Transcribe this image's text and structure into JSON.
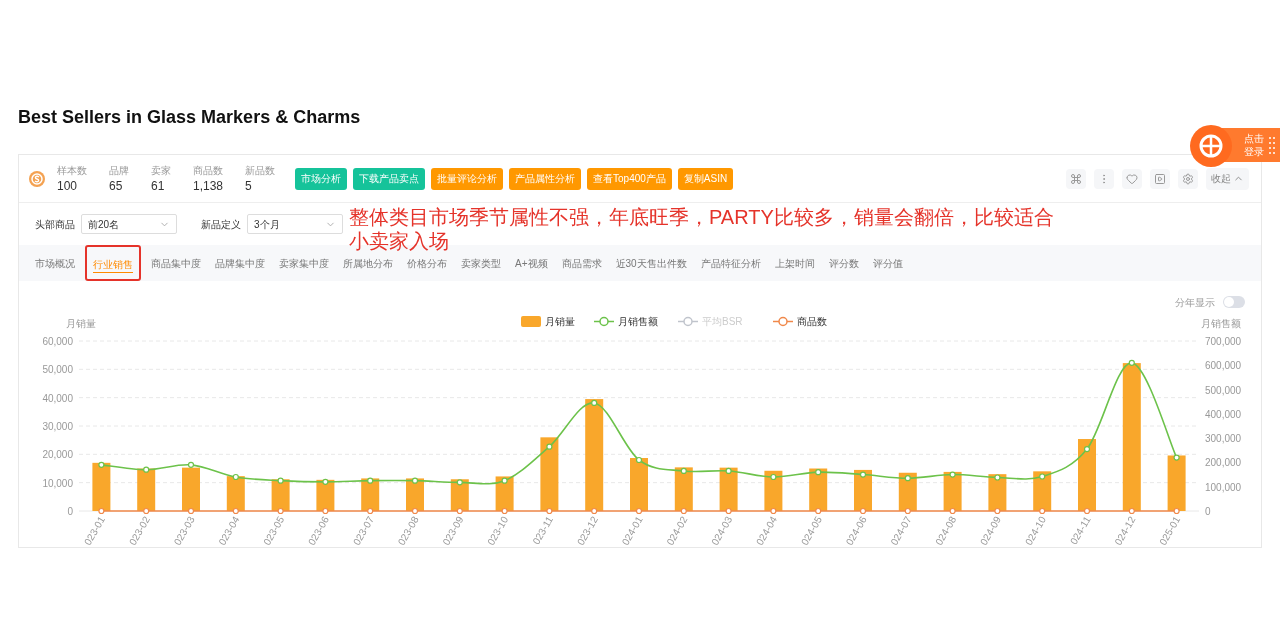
{
  "page_title": "Best Sellers in Glass Markers & Charms",
  "float_login": {
    "line1": "点击",
    "line2": "登录"
  },
  "stats": [
    {
      "label": "样本数",
      "value": "100"
    },
    {
      "label": "品牌",
      "value": "65"
    },
    {
      "label": "卖家",
      "value": "61"
    },
    {
      "label": "商品数",
      "value": "1,138"
    },
    {
      "label": "新品数",
      "value": "5"
    }
  ],
  "actions": [
    {
      "label": "市场分析",
      "kind": "teal"
    },
    {
      "label": "下载产品卖点",
      "kind": "teal"
    },
    {
      "label": "批量评论分析",
      "kind": "orange"
    },
    {
      "label": "产品属性分析",
      "kind": "orange"
    },
    {
      "label": "查看Top400产品",
      "kind": "orange"
    },
    {
      "label": "复制ASIN",
      "kind": "orange"
    }
  ],
  "collapse_button": "收起",
  "filters": [
    {
      "label": "头部商品",
      "value": "前20名"
    },
    {
      "label": "新品定义",
      "value": "3个月"
    }
  ],
  "annotation": "整体类目市场季节属性不强，年底旺季，PARTY比较多，销量会翻倍，比较适合小卖家入场",
  "tabs": [
    {
      "label": "市场概况",
      "selected": false
    },
    {
      "label": "行业销售",
      "selected": true
    },
    {
      "label": "商品集中度",
      "selected": false
    },
    {
      "label": "品牌集中度",
      "selected": false
    },
    {
      "label": "卖家集中度",
      "selected": false
    },
    {
      "label": "所属地分布",
      "selected": false
    },
    {
      "label": "价格分布",
      "selected": false
    },
    {
      "label": "卖家类型",
      "selected": false
    },
    {
      "label": "A+视频",
      "selected": false
    },
    {
      "label": "商品需求",
      "selected": false
    },
    {
      "label": "近30天售出件数",
      "selected": false
    },
    {
      "label": "产品特征分析",
      "selected": false
    },
    {
      "label": "上架时间",
      "selected": false
    },
    {
      "label": "评分数",
      "selected": false
    },
    {
      "label": "评分值",
      "selected": false
    }
  ],
  "chart": {
    "toggle": {
      "label": "分年显示",
      "on": false
    },
    "hidden_legend_item": {
      "label": "平均BSR",
      "color": "#c0c4cc",
      "disabled": true
    },
    "chart_data": {
      "type": "bar",
      "ylabel": "月销量",
      "y2label": "月销售额",
      "stacked": false,
      "grid": true,
      "legend": "top",
      "categories": [
        "023-01",
        "023-02",
        "023-03",
        "023-04",
        "023-05",
        "023-06",
        "023-07",
        "023-08",
        "023-09",
        "023-10",
        "023-11",
        "023-12",
        "024-01",
        "024-02",
        "024-03",
        "024-04",
        "024-05",
        "024-06",
        "024-07",
        "024-08",
        "024-09",
        "024-10",
        "024-11",
        "024-12",
        "025-01"
      ],
      "series": [
        {
          "name": "月销量",
          "type": "bar",
          "color": "#f9a72b",
          "values": [
            17000,
            15000,
            15300,
            12300,
            11200,
            11000,
            11500,
            11500,
            11200,
            12200,
            26000,
            39500,
            18700,
            15400,
            15300,
            14200,
            15000,
            14500,
            13500,
            13800,
            13000,
            14000,
            25400,
            52200,
            19600
          ]
        },
        {
          "name": "月销售额",
          "type": "line",
          "axis": "y2",
          "marker": "circle",
          "color": "#6cc24a",
          "values": [
            190000,
            170000,
            190000,
            140000,
            125000,
            120000,
            125000,
            125000,
            118000,
            125000,
            265000,
            445000,
            210000,
            165000,
            165000,
            140000,
            160000,
            150000,
            135000,
            150000,
            138000,
            142000,
            255000,
            610000,
            220000
          ]
        },
        {
          "name": "商品数",
          "type": "line",
          "marker": "circle",
          "color": "#f0884a",
          "values": [
            0,
            0,
            0,
            0,
            0,
            0,
            0,
            0,
            0,
            0,
            0,
            0,
            0,
            0,
            0,
            0,
            0,
            0,
            0,
            0,
            0,
            0,
            0,
            0,
            0
          ]
        }
      ],
      "ylim": [
        0,
        60000
      ],
      "yticks": [
        {
          "value": 0,
          "label": "0"
        },
        {
          "value": 10000,
          "label": "10,000"
        },
        {
          "value": 20000,
          "label": "20,000"
        },
        {
          "value": 30000,
          "label": "30,000"
        },
        {
          "value": 40000,
          "label": "40,000"
        },
        {
          "value": 50000,
          "label": "50,000"
        },
        {
          "value": 60000,
          "label": "60,000"
        }
      ],
      "y2lim": [
        0,
        700000
      ],
      "y2ticks": [
        {
          "value": 0,
          "label": "0"
        },
        {
          "value": 100000,
          "label": "100,000"
        },
        {
          "value": 200000,
          "label": "200,000"
        },
        {
          "value": 300000,
          "label": "300,000"
        },
        {
          "value": 400000,
          "label": "400,000"
        },
        {
          "value": 500000,
          "label": "500,000"
        },
        {
          "value": 600000,
          "label": "600,000"
        },
        {
          "value": 700000,
          "label": "700,000"
        }
      ]
    }
  }
}
